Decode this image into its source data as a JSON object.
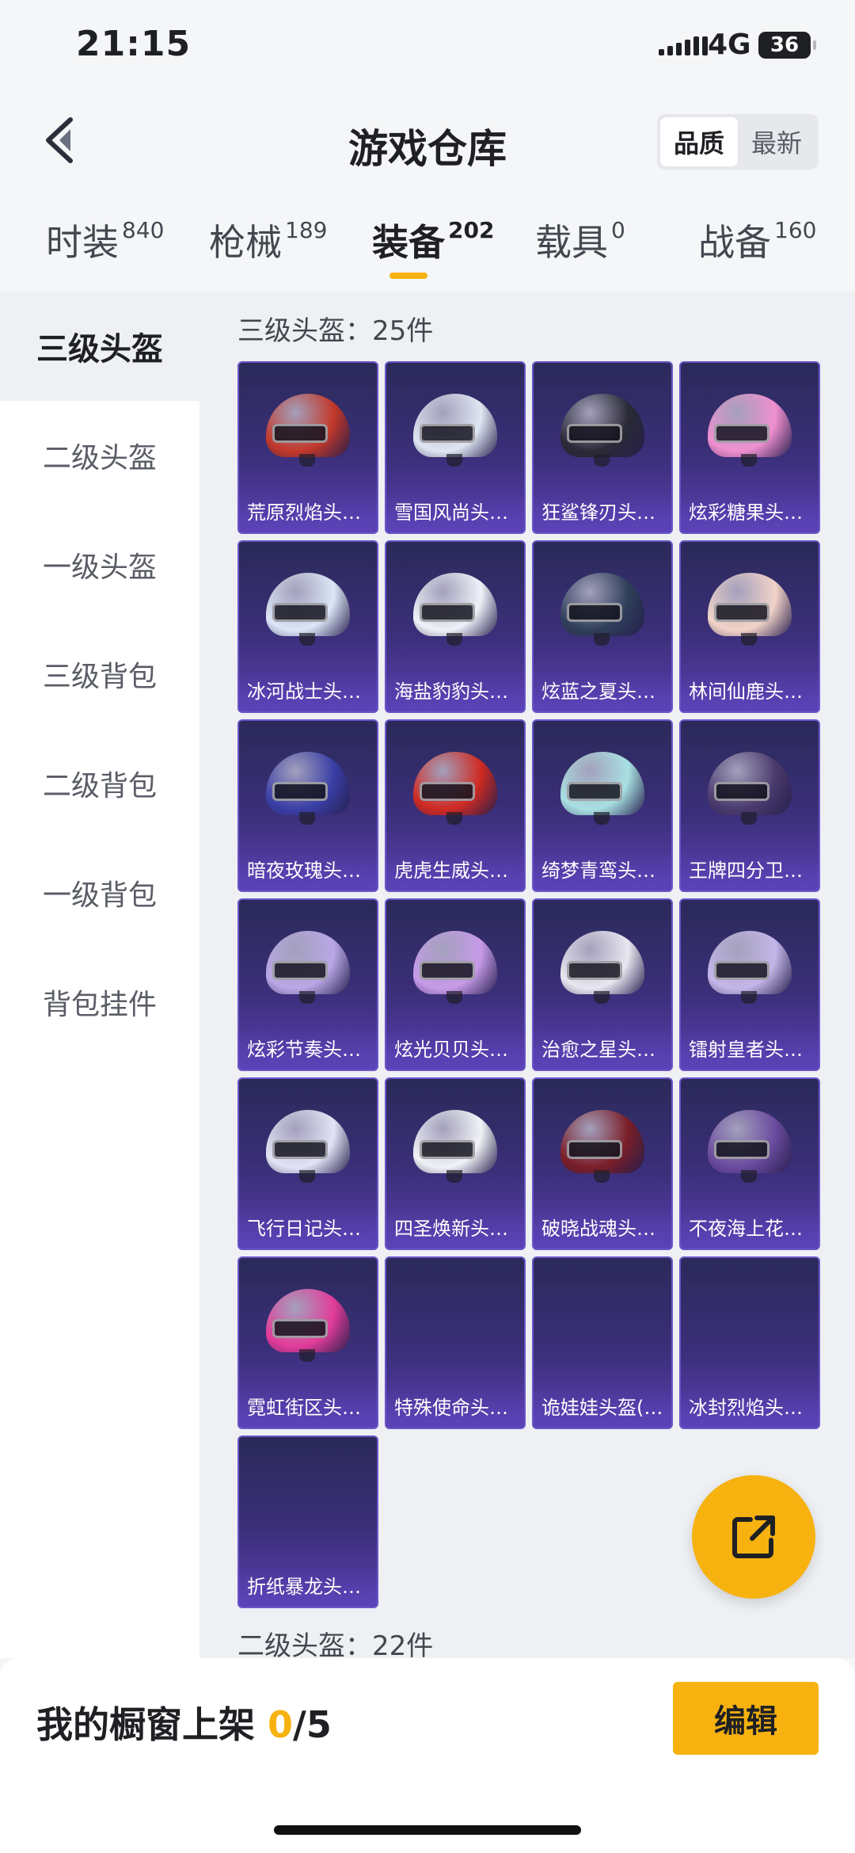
{
  "status_bar": {
    "time": "21:15",
    "network": "4G",
    "battery": "36"
  },
  "header": {
    "title": "游戏仓库",
    "sort_options": [
      "品质",
      "最新"
    ],
    "sort_active": "品质"
  },
  "tabs": [
    {
      "label": "时装",
      "count": "840"
    },
    {
      "label": "枪械",
      "count": "189"
    },
    {
      "label": "装备",
      "count": "202"
    },
    {
      "label": "载具",
      "count": "0"
    },
    {
      "label": "战备",
      "count": "160"
    }
  ],
  "active_tab": "装备",
  "sidebar": {
    "items": [
      "三级头盔",
      "二级头盔",
      "一级头盔",
      "三级背包",
      "二级背包",
      "一级背包",
      "背包挂件"
    ],
    "active": "三级头盔"
  },
  "sections": [
    {
      "title": "三级头盔：25件",
      "items": [
        {
          "name": "荒原烈焰头…",
          "color": "#c2382a"
        },
        {
          "name": "雪国风尚头…",
          "color": "#dfe6f2"
        },
        {
          "name": "狂鲨锋刃头…",
          "color": "#2a2a36"
        },
        {
          "name": "炫彩糖果头…",
          "color": "#ef8fcf"
        },
        {
          "name": "冰河战士头…",
          "color": "#dbe6f6"
        },
        {
          "name": "海盐豹豹头…",
          "color": "#eef2f8"
        },
        {
          "name": "炫蓝之夏头…",
          "color": "#2f3e5a"
        },
        {
          "name": "林间仙鹿头…",
          "color": "#f2d3c8"
        },
        {
          "name": "暗夜玫瑰头…",
          "color": "#3a3fa6"
        },
        {
          "name": "虎虎生威头…",
          "color": "#cf2a22"
        },
        {
          "name": "绮梦青鸾头…",
          "color": "#a8e0e2"
        },
        {
          "name": "王牌四分卫…",
          "color": "#4a3a6e"
        },
        {
          "name": "炫彩节奏头…",
          "color": "#b9a7e6"
        },
        {
          "name": "炫光贝贝头…",
          "color": "#c69ae8"
        },
        {
          "name": "治愈之星头…",
          "color": "#e9e6f0"
        },
        {
          "name": "镭射皇者头…",
          "color": "#c4b6e8"
        },
        {
          "name": "飞行日记头…",
          "color": "#e2e4f6"
        },
        {
          "name": "四圣焕新头…",
          "color": "#f0f2f6"
        },
        {
          "name": "破晓战魂头…",
          "color": "#7a1e28"
        },
        {
          "name": "不夜海上花…",
          "color": "#6a4a9e"
        },
        {
          "name": "霓虹街区头…",
          "color": "#e23c9a"
        },
        {
          "name": "特殊使命头…",
          "color": ""
        },
        {
          "name": "诡娃娃头盔(…",
          "color": ""
        },
        {
          "name": "冰封烈焰头…",
          "color": ""
        },
        {
          "name": "折纸暴龙头…",
          "color": ""
        }
      ]
    },
    {
      "title": "二级头盔：22件"
    }
  ],
  "bottom_bar": {
    "label": "我的橱窗上架",
    "count": "0",
    "total": "/5",
    "edit_label": "编辑"
  },
  "colors": {
    "accent": "#f7b20f",
    "card_top": "#2b2a5a",
    "card_bottom": "#5b3fb0"
  }
}
